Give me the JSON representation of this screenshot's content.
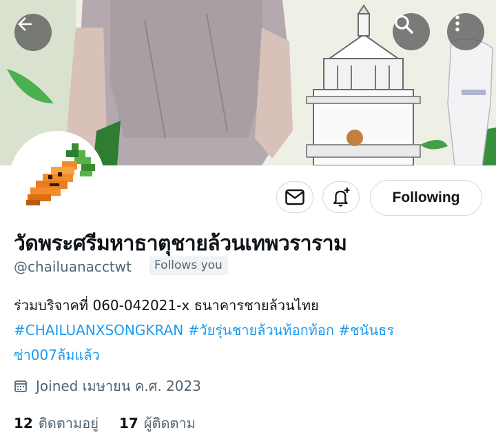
{
  "header": {
    "back_icon": "arrow-left-icon",
    "search_icon": "search-icon",
    "more_icon": "more-vertical-icon"
  },
  "actions": {
    "message_icon": "mail-icon",
    "notify_icon": "bell-plus-icon",
    "following_label": "Following"
  },
  "profile": {
    "display_name": "วัดพระศรีมหาธาตุชายล้วนเทพวราราม",
    "handle": "@chailuanacctwt",
    "follows_you": "Follows you",
    "bio": {
      "line1": "ร่วมบริจาคที่ 060-042021-x ธนาคารชายล้วนไทย",
      "hashtag1": "#CHAILUANXSONGKRAN",
      "hashtag2": "#วัยรุ่นชายล้วนท้อกท้อก",
      "hashtag3_part1": "#ชนันธร",
      "hashtag3_part2": "ซ่า007ล้มแล้ว"
    },
    "joined": "Joined เมษายน ค.ศ. 2023",
    "following_count": "12",
    "following_label": "ติดตามอยู่",
    "followers_count": "17",
    "followers_label": "ผู้ติดตาม"
  },
  "colors": {
    "link": "#1d9bf0",
    "secondary_text": "#536471",
    "border": "#cfd9de"
  }
}
